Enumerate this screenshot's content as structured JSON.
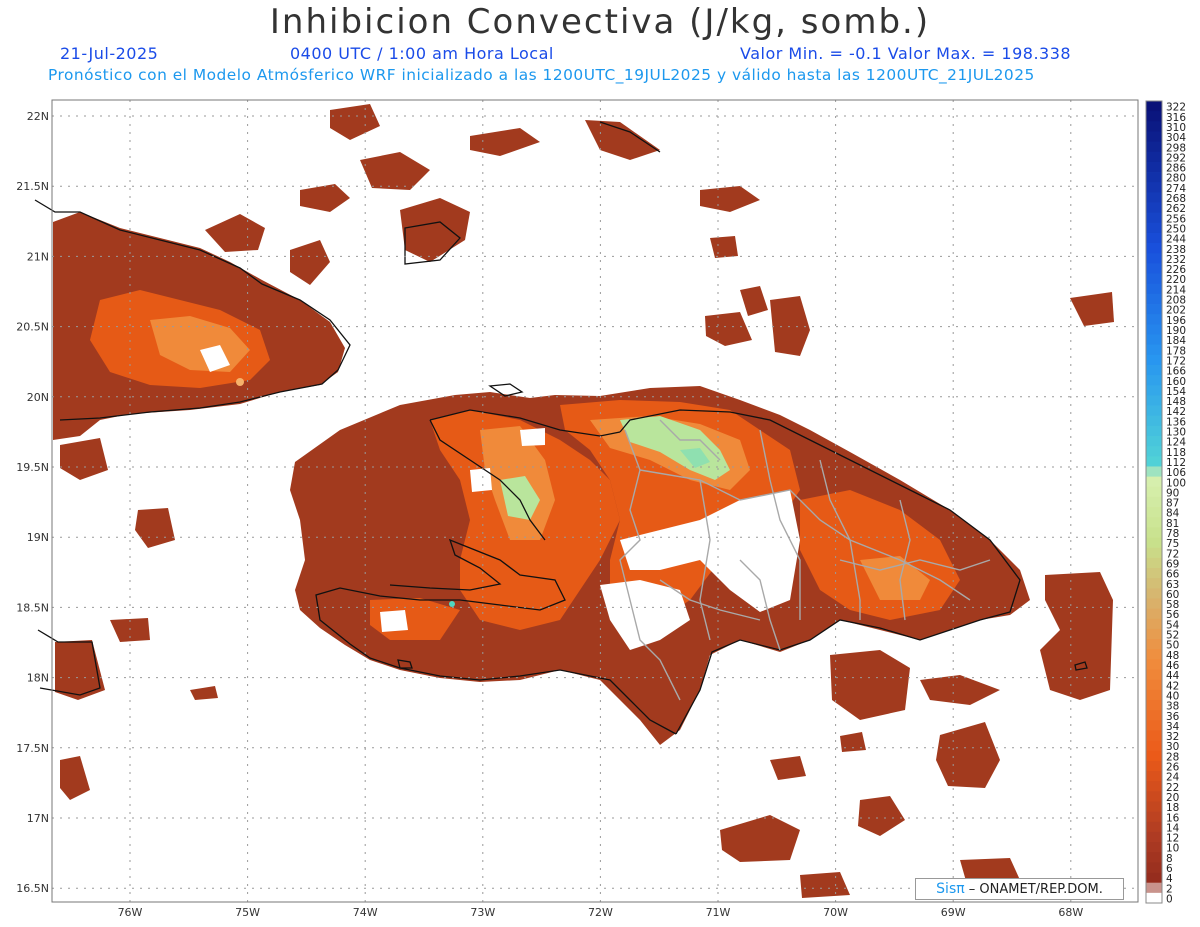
{
  "header": {
    "title": "Inhibicion Convectiva (J/kg, somb.)",
    "date": "21-Jul-2025",
    "time": "0400 UTC / 1:00 am Hora Local",
    "minmax": "Valor Min. = -0.1  Valor Max. = 198.338",
    "forecast": "Pronóstico con el Modelo Atmósferico WRF inicializado a las 1200UTC_19JUL2025 y válido hasta las  1200UTC_21JUL2025"
  },
  "axes": {
    "lat_labels": [
      "22N",
      "21.5N",
      "21N",
      "20.5N",
      "20N",
      "19.5N",
      "19N",
      "18.5N",
      "18N",
      "17.5N",
      "17N",
      "16.5N"
    ],
    "lon_labels": [
      "76W",
      "75W",
      "74W",
      "73W",
      "72W",
      "71W",
      "70W",
      "69W",
      "68W"
    ]
  },
  "legend": {
    "labels": [
      "322",
      "316",
      "310",
      "304",
      "298",
      "292",
      "286",
      "280",
      "274",
      "268",
      "262",
      "256",
      "250",
      "244",
      "238",
      "232",
      "226",
      "220",
      "214",
      "208",
      "202",
      "196",
      "190",
      "184",
      "178",
      "172",
      "166",
      "160",
      "154",
      "148",
      "142",
      "136",
      "130",
      "124",
      "118",
      "112",
      "106",
      "100",
      "90",
      "87",
      "84",
      "81",
      "78",
      "75",
      "72",
      "69",
      "66",
      "63",
      "60",
      "58",
      "56",
      "54",
      "52",
      "50",
      "48",
      "46",
      "44",
      "42",
      "40",
      "38",
      "36",
      "34",
      "32",
      "30",
      "28",
      "26",
      "24",
      "22",
      "20",
      "18",
      "16",
      "14",
      "12",
      "10",
      "8",
      "6",
      "4",
      "2",
      "0"
    ]
  },
  "credit": {
    "sis": "Sisπ",
    "org": " – ONAMET/REP.DOM."
  },
  "colors": {
    "dark_fill": "#a23a1e",
    "mid_fill": "#e65a16",
    "light_fill": "#f08a3a",
    "pale_fill": "#b9e59c",
    "cyan_fill": "#4fd8c2",
    "coast": "#111111",
    "province": "#a9a9a9"
  }
}
